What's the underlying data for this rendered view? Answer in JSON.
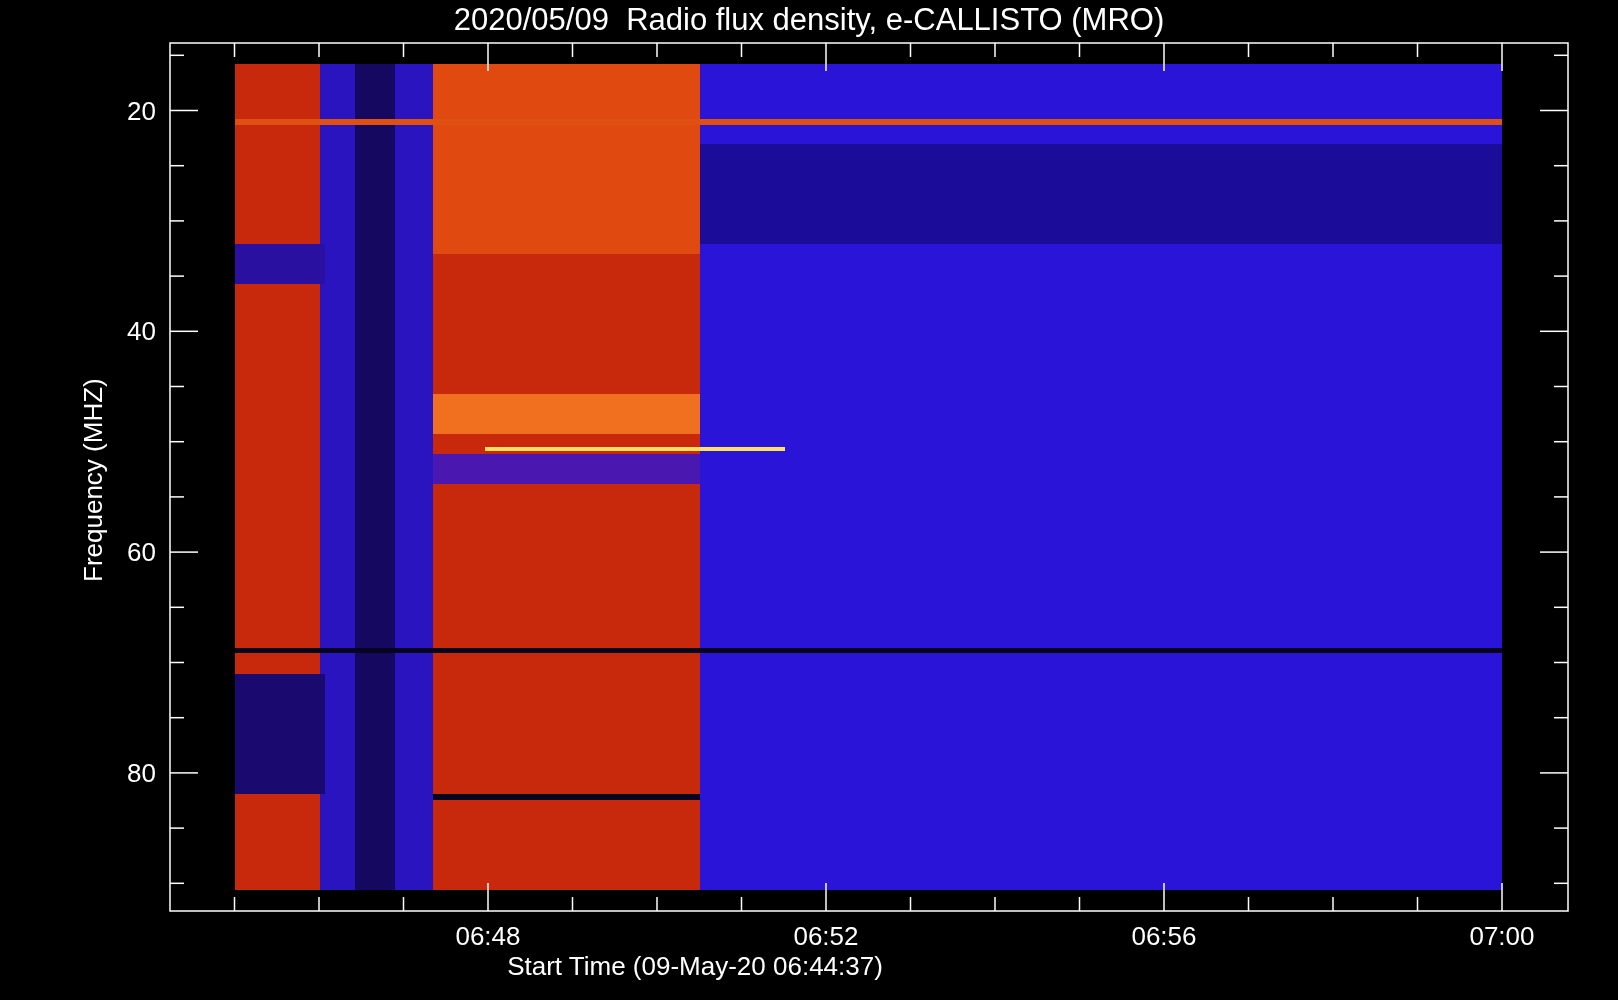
{
  "plot": {
    "title": "2020/05/09  Radio flux density, e-CALLISTO (MRO)",
    "ylabel": "Frequency (MHZ)",
    "xlabel": "Start Time (09-May-20 06:44:37)",
    "yticks": [
      "20",
      "40",
      "60",
      "80"
    ],
    "xticks": [
      "06:48",
      "06:52",
      "06:56",
      "07:00"
    ]
  }
}
